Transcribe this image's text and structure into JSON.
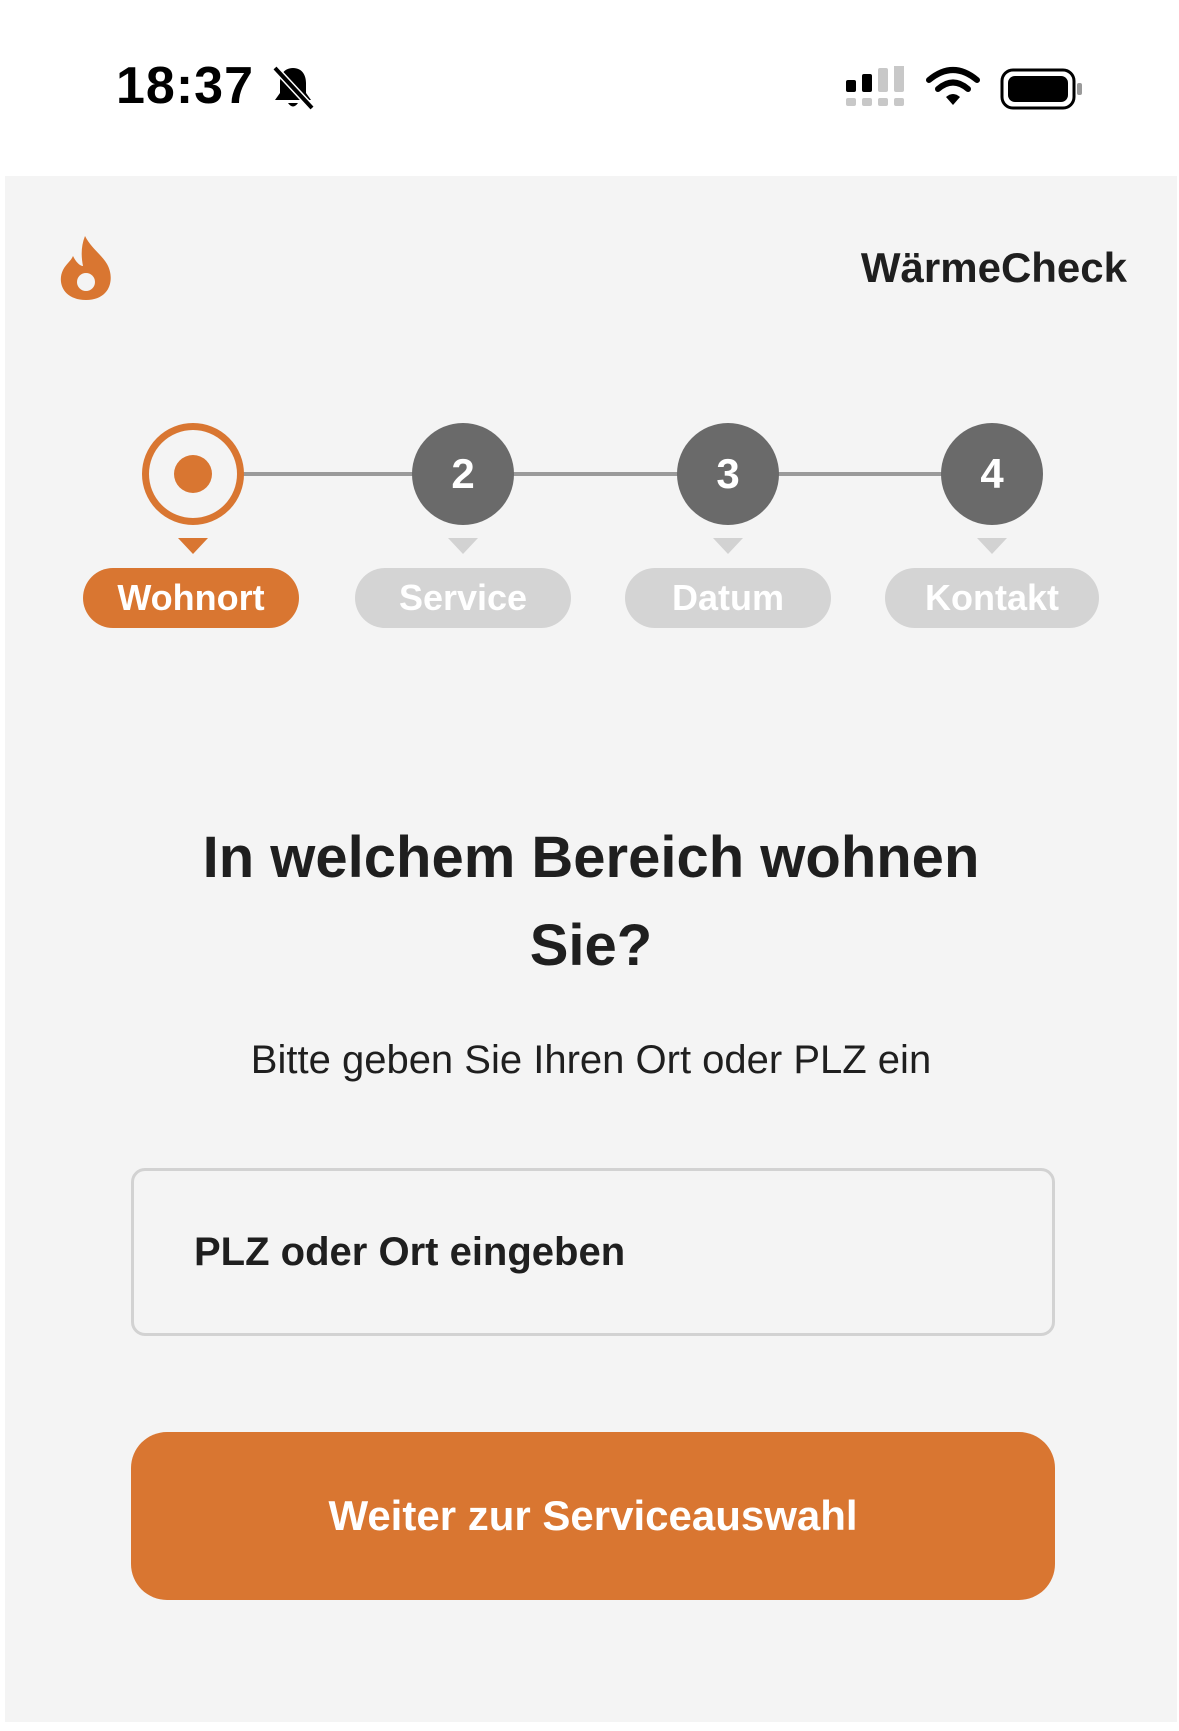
{
  "status_bar": {
    "time": "18:37",
    "icons": [
      "bell-muted-icon",
      "cellular-signal-icon",
      "wifi-icon",
      "battery-icon"
    ]
  },
  "header": {
    "logo_icon": "flame-icon",
    "brand": "WärmeCheck"
  },
  "stepper": {
    "steps": [
      {
        "number": "1",
        "label": "Wohnort",
        "state": "active"
      },
      {
        "number": "2",
        "label": "Service",
        "state": "inactive"
      },
      {
        "number": "3",
        "label": "Datum",
        "state": "inactive"
      },
      {
        "number": "4",
        "label": "Kontakt",
        "state": "inactive"
      }
    ]
  },
  "main": {
    "question_line1": "In welchem Bereich wohnen",
    "question_line2": "Sie?",
    "subtitle": "Bitte geben Sie Ihren Ort oder PLZ ein",
    "location_input": {
      "value": "",
      "placeholder": "PLZ oder Ort eingeben"
    },
    "next_button_label": "Weiter zur Serviceauswahl"
  },
  "colors": {
    "accent": "#d97631",
    "background": "#f4f4f4",
    "inactive_step": "#6a6a6a",
    "inactive_pill": "#d4d4d4",
    "text": "#1f1f1f"
  }
}
